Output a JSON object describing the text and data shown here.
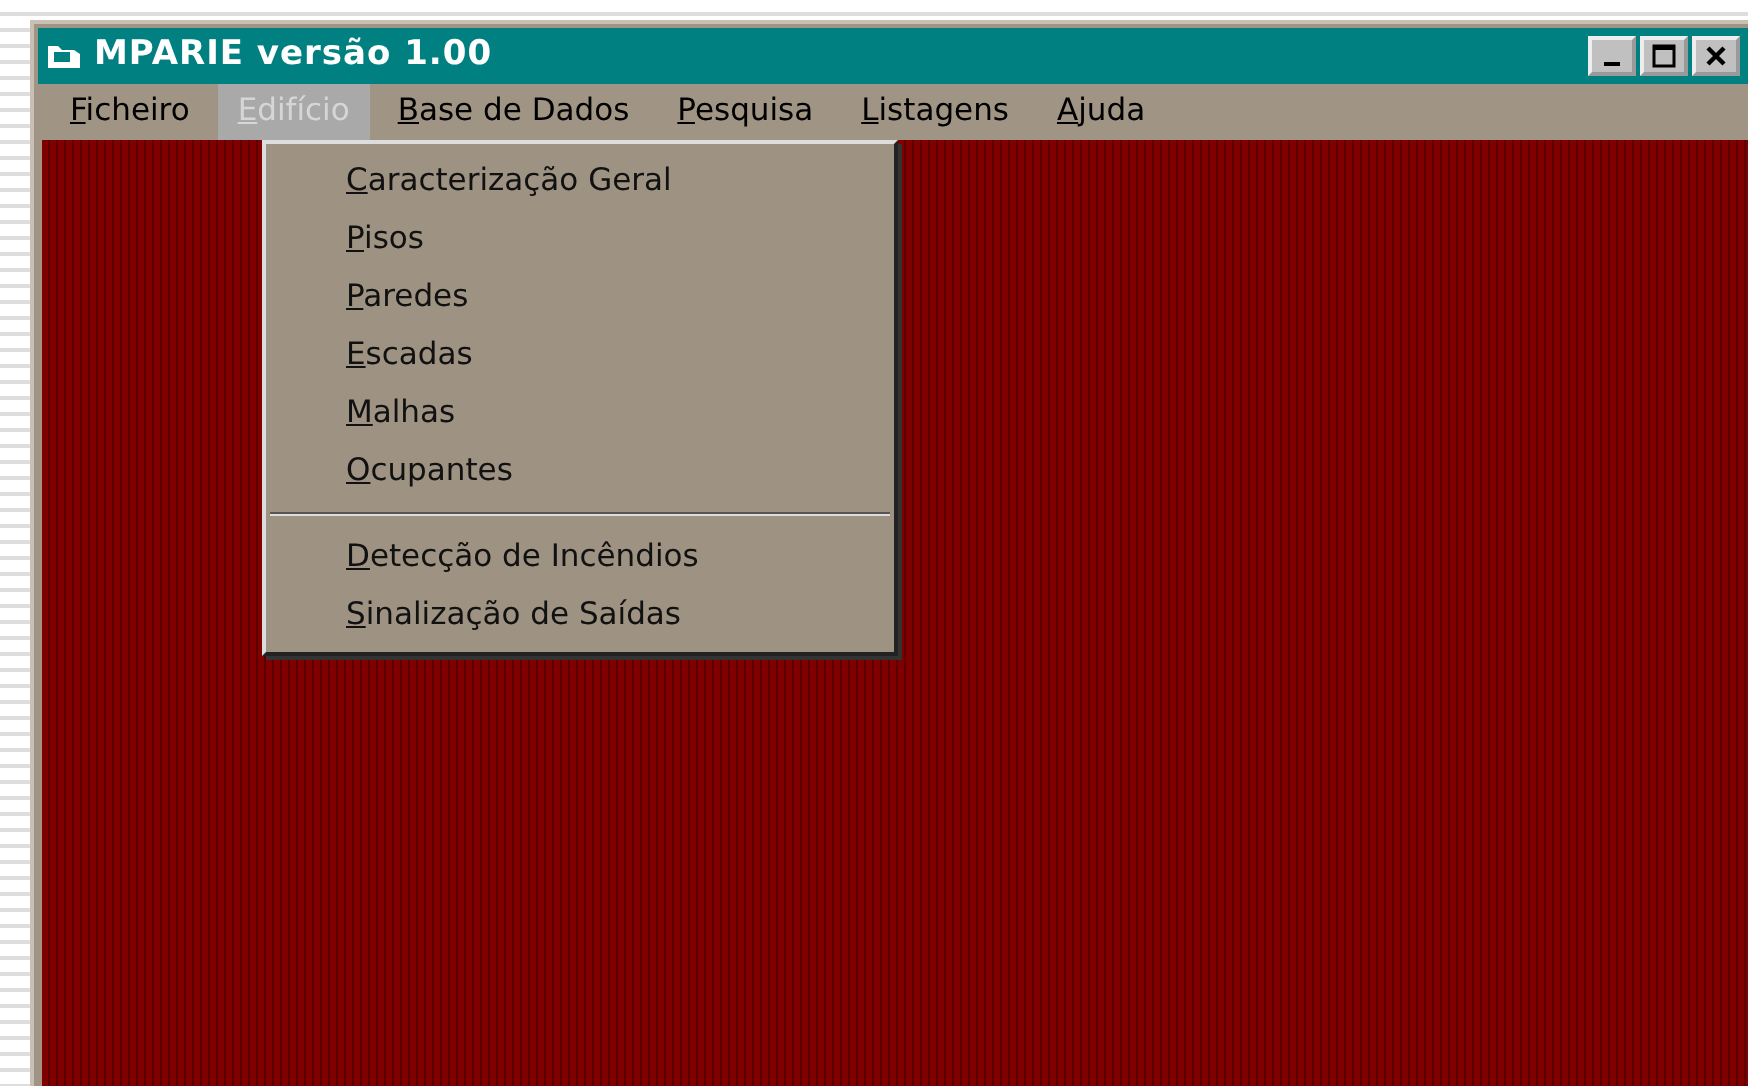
{
  "window": {
    "title": "MPARIE versão 1.00"
  },
  "menu_bar": [
    {
      "label": "Ficheiro",
      "selected": false
    },
    {
      "label": "Edifício",
      "selected": true
    },
    {
      "label": "Base de Dados",
      "selected": false
    },
    {
      "label": "Pesquisa",
      "selected": false
    },
    {
      "label": "Listagens",
      "selected": false
    },
    {
      "label": "Ajuda",
      "selected": false
    }
  ],
  "dropdown": [
    {
      "kind": "item",
      "label": "Caracterização Geral"
    },
    {
      "kind": "item",
      "label": "Pisos"
    },
    {
      "kind": "item",
      "label": "Paredes"
    },
    {
      "kind": "item",
      "label": "Escadas"
    },
    {
      "kind": "item",
      "label": "Malhas"
    },
    {
      "kind": "item",
      "label": "Ocupantes"
    },
    {
      "kind": "separator"
    },
    {
      "kind": "item",
      "label": "Detecção de Incêndios"
    },
    {
      "kind": "item",
      "label": "Sinalização de Saídas"
    }
  ]
}
